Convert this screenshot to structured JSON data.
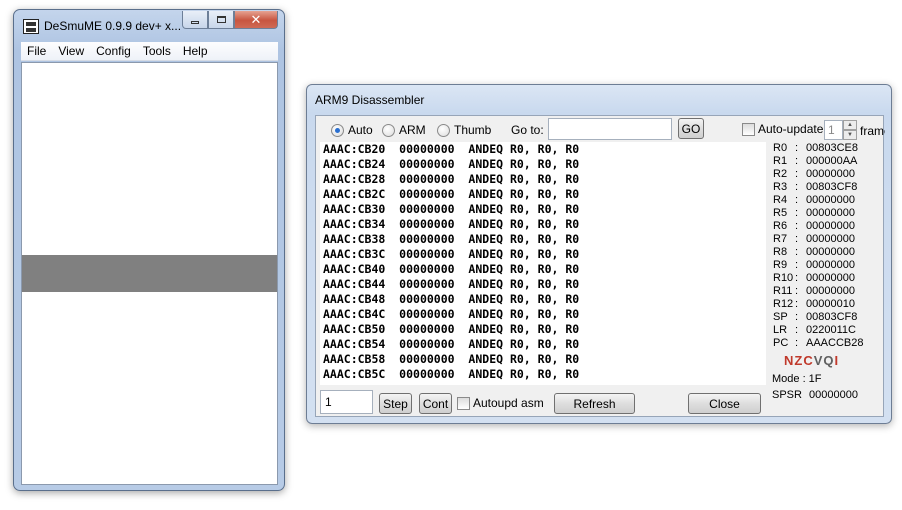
{
  "desmume": {
    "title": "DeSmuME 0.9.9 dev+ x...",
    "menu": [
      "File",
      "View",
      "Config",
      "Tools",
      "Help"
    ],
    "close_glyph": "✕"
  },
  "disassembler": {
    "title": "ARM9 Disassembler",
    "modes": [
      {
        "label": "Auto",
        "checked": true
      },
      {
        "label": "ARM",
        "checked": false
      },
      {
        "label": "Thumb",
        "checked": false
      }
    ],
    "goto_label": "Go to:",
    "goto_value": "",
    "go_button": "GO",
    "auto_update_label": "Auto-update",
    "auto_update_checked": false,
    "frames_value": "1",
    "frames_label": "frames",
    "code_lines": [
      {
        "addr": "AAAC:CB20",
        "hex": "00000000",
        "instr": "ANDEQ R0, R0, R0"
      },
      {
        "addr": "AAAC:CB24",
        "hex": "00000000",
        "instr": "ANDEQ R0, R0, R0"
      },
      {
        "addr": "AAAC:CB28",
        "hex": "00000000",
        "instr": "ANDEQ R0, R0, R0"
      },
      {
        "addr": "AAAC:CB2C",
        "hex": "00000000",
        "instr": "ANDEQ R0, R0, R0"
      },
      {
        "addr": "AAAC:CB30",
        "hex": "00000000",
        "instr": "ANDEQ R0, R0, R0"
      },
      {
        "addr": "AAAC:CB34",
        "hex": "00000000",
        "instr": "ANDEQ R0, R0, R0"
      },
      {
        "addr": "AAAC:CB38",
        "hex": "00000000",
        "instr": "ANDEQ R0, R0, R0"
      },
      {
        "addr": "AAAC:CB3C",
        "hex": "00000000",
        "instr": "ANDEQ R0, R0, R0"
      },
      {
        "addr": "AAAC:CB40",
        "hex": "00000000",
        "instr": "ANDEQ R0, R0, R0"
      },
      {
        "addr": "AAAC:CB44",
        "hex": "00000000",
        "instr": "ANDEQ R0, R0, R0"
      },
      {
        "addr": "AAAC:CB48",
        "hex": "00000000",
        "instr": "ANDEQ R0, R0, R0"
      },
      {
        "addr": "AAAC:CB4C",
        "hex": "00000000",
        "instr": "ANDEQ R0, R0, R0"
      },
      {
        "addr": "AAAC:CB50",
        "hex": "00000000",
        "instr": "ANDEQ R0, R0, R0"
      },
      {
        "addr": "AAAC:CB54",
        "hex": "00000000",
        "instr": "ANDEQ R0, R0, R0"
      },
      {
        "addr": "AAAC:CB58",
        "hex": "00000000",
        "instr": "ANDEQ R0, R0, R0"
      },
      {
        "addr": "AAAC:CB5C",
        "hex": "00000000",
        "instr": "ANDEQ R0, R0, R0"
      }
    ],
    "registers": [
      {
        "name": "R0",
        "value": "00803CE8"
      },
      {
        "name": "R1",
        "value": "000000AA"
      },
      {
        "name": "R2",
        "value": "00000000"
      },
      {
        "name": "R3",
        "value": "00803CF8"
      },
      {
        "name": "R4",
        "value": "00000000"
      },
      {
        "name": "R5",
        "value": "00000000"
      },
      {
        "name": "R6",
        "value": "00000000"
      },
      {
        "name": "R7",
        "value": "00000000"
      },
      {
        "name": "R8",
        "value": "00000000"
      },
      {
        "name": "R9",
        "value": "00000000"
      },
      {
        "name": "R10",
        "value": "00000000"
      },
      {
        "name": "R11",
        "value": "00000000"
      },
      {
        "name": "R12",
        "value": "00000010"
      },
      {
        "name": "SP",
        "value": "00803CF8"
      },
      {
        "name": "LR",
        "value": "0220011C"
      },
      {
        "name": "PC",
        "value": "AAACCB28"
      }
    ],
    "flags": [
      {
        "letter": "N",
        "color": "#c0392b"
      },
      {
        "letter": "Z",
        "color": "#c0392b"
      },
      {
        "letter": "C",
        "color": "#c0392b"
      },
      {
        "letter": "V",
        "color": "#606060"
      },
      {
        "letter": "Q",
        "color": "#606060"
      },
      {
        "letter": "I",
        "color": "#c0392b"
      }
    ],
    "mode_text": "Mode : 1F",
    "spsr_label": "SPSR",
    "spsr_value": "00000000",
    "step_value": "1",
    "step_button": "Step",
    "cont_button": "Cont",
    "autoupd_asm_label": "Autoupd asm",
    "refresh_button": "Refresh",
    "close_button": "Close"
  }
}
